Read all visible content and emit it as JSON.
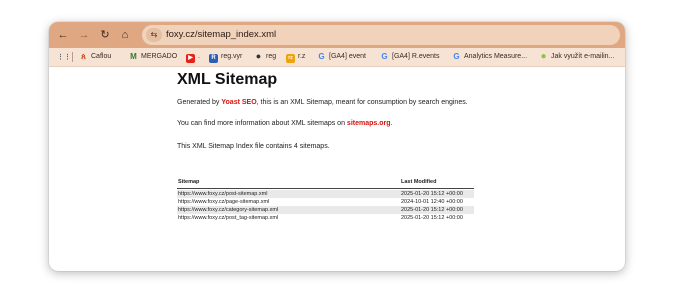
{
  "browser": {
    "nav": {
      "back_icon": "←",
      "forward_icon": "→",
      "reload_icon": "↻",
      "home_icon": "⌂"
    },
    "site_info_icon": "⇆",
    "url": "foxy.cz/sitemap_index.xml",
    "bookmarks": [
      {
        "label": "",
        "icon": "apps-icon",
        "icon_glyph": "⋮⋮",
        "color": "#5f6368"
      },
      {
        "label": "Caflou",
        "icon": "caflou-icon",
        "icon_glyph": "ጰ",
        "color": "#d34a1f"
      },
      {
        "label": "MERGADO",
        "icon": "mergado-icon",
        "icon_glyph": "M",
        "color": "#2e7d32"
      },
      {
        "label": ".",
        "icon": "youtube-icon",
        "icon_glyph": "▶",
        "color": "#e62117"
      },
      {
        "label": "reg.vyr",
        "icon": "r-icon",
        "icon_glyph": "R",
        "color": "#2b5fb3"
      },
      {
        "label": "reg",
        "icon": "globe-icon",
        "icon_glyph": "●",
        "color": "#333333"
      },
      {
        "label": "r.z",
        "icon": "rz-icon",
        "icon_glyph": "rz",
        "color": "#f0a30a"
      },
      {
        "label": "[GA4] event",
        "icon": "google-icon",
        "icon_glyph": "G",
        "color": "#4285f4"
      },
      {
        "label": "[GA4] R.events",
        "icon": "google-icon",
        "icon_glyph": "G",
        "color": "#4285f4"
      },
      {
        "label": "Analytics Measure...",
        "icon": "google-icon",
        "icon_glyph": "G",
        "color": "#4285f4"
      },
      {
        "label": "Jak využít e-mailin...",
        "icon": "leaf-icon",
        "icon_glyph": "●",
        "color": "#8dc63f"
      }
    ]
  },
  "page": {
    "title": "XML Sitemap",
    "generated_pre": "Generated by ",
    "generated_link": "Yoast SEO",
    "generated_post": ", this is an XML Sitemap, meant for consumption by search engines.",
    "info_pre": "You can find more information about XML sitemaps on ",
    "info_link": "sitemaps.org",
    "info_post": ".",
    "count_text": "This XML Sitemap Index file contains 4 sitemaps.",
    "table": {
      "headers": {
        "sitemap": "Sitemap",
        "last_modified": "Last Modified"
      },
      "rows": [
        {
          "loc": "https://www.foxy.cz/post-sitemap.xml",
          "lastmod": "2025-01-20 15:12 +00:00"
        },
        {
          "loc": "https://www.foxy.cz/page-sitemap.xml",
          "lastmod": "2024-10-01 12:40 +00:00"
        },
        {
          "loc": "https://www.foxy.cz/category-sitemap.xml",
          "lastmod": "2025-01-20 15:12 +00:00"
        },
        {
          "loc": "https://www.foxy.cz/post_tag-sitemap.xml",
          "lastmod": "2025-01-20 15:12 +00:00"
        }
      ]
    }
  }
}
